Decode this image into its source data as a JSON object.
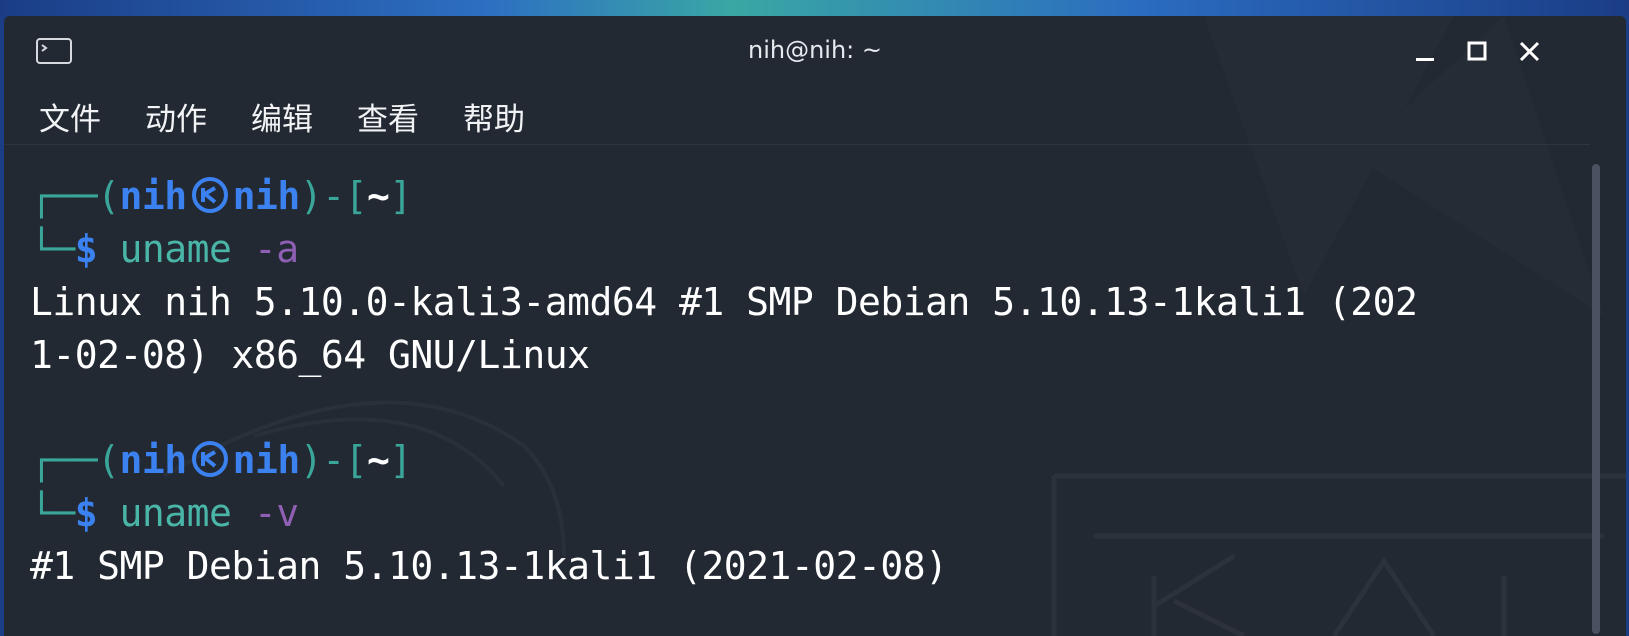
{
  "window": {
    "title": "nih@nih: ~",
    "icon": "terminal-icon",
    "controls": [
      "minimize-icon",
      "maximize-icon",
      "close-icon"
    ]
  },
  "menu": {
    "items": [
      "文件",
      "动作",
      "编辑",
      "查看",
      "帮助"
    ]
  },
  "terminal": {
    "prompt1": {
      "corner_top": "┌──",
      "open_paren": "(",
      "user": "nih",
      "host": "nih",
      "close_paren": ")",
      "dash": "-",
      "open_bracket": "[",
      "dir": "~",
      "close_bracket": "]",
      "corner_bottom": "└─",
      "dollar": "$",
      "command": "uname",
      "option": "-a"
    },
    "output1_line1": "Linux nih 5.10.0-kali3-amd64 #1 SMP Debian 5.10.13-1kali1 (202",
    "output1_line2": "1-02-08) x86_64 GNU/Linux",
    "prompt2": {
      "corner_top": "┌──",
      "open_paren": "(",
      "user": "nih",
      "host": "nih",
      "close_paren": ")",
      "dash": "-",
      "open_bracket": "[",
      "dir": "~",
      "close_bracket": "]",
      "corner_bottom": "└─",
      "dollar": "$",
      "command": "uname",
      "option": "-v"
    },
    "output2_line1": "#1 SMP Debian 5.10.13-1kali1 (2021-02-08)"
  },
  "colors": {
    "background": "#232933",
    "prompt_blue": "#3b82f0",
    "bracket_teal": "#3aa69a",
    "command_teal": "#49b6a8",
    "option_purple": "#8e5fb3",
    "text": "#ffffff"
  }
}
